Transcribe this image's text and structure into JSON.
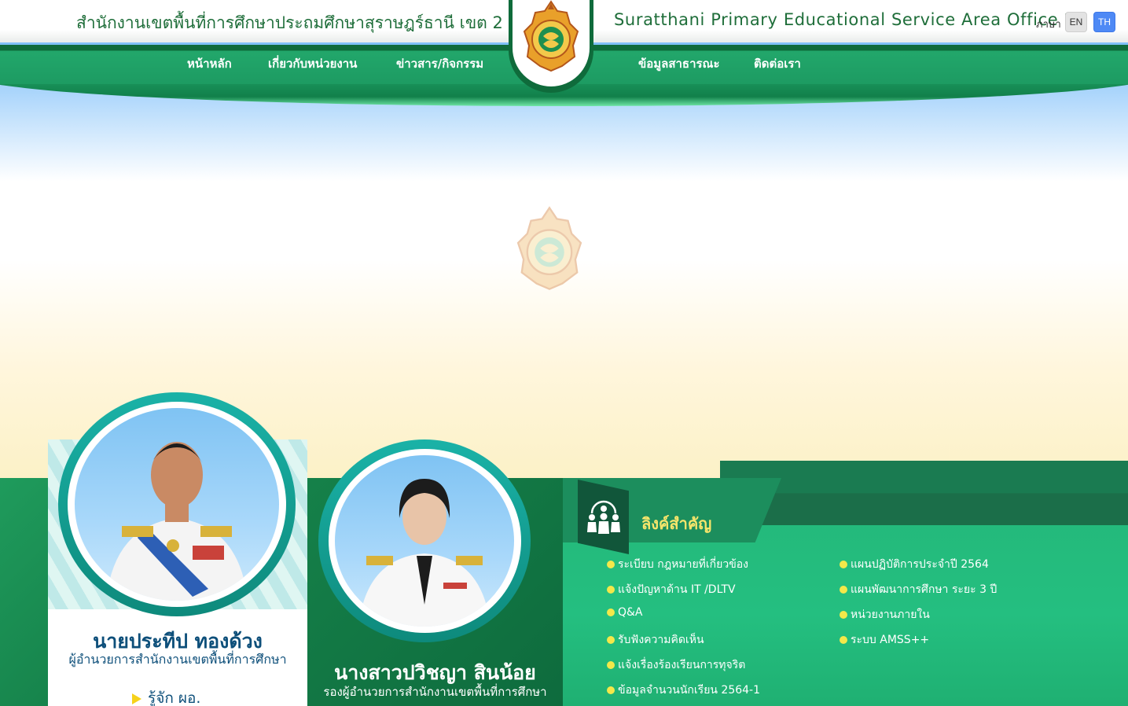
{
  "header": {
    "title_th": "สำนักงานเขตพื้นที่การศึกษาประถมศึกษาสุราษฎร์ธานี เขต 2",
    "title_en": "Suratthani Primary Educational Service Area Office 2",
    "lang_label": "ภาษา",
    "lang_en": "EN",
    "lang_th": "TH"
  },
  "nav": {
    "items": [
      "หน้าหลัก",
      "เกี่ยวกับหน่วยงาน",
      "ข่าวสาร/กิจกรรม",
      "ข้อมูลสาธารณะ",
      "ติดต่อเรา"
    ]
  },
  "colors": {
    "brand_green": "#1d9b62",
    "dark_green": "#0f6b3b",
    "accent_yellow": "#f6e56b",
    "lang_active": "#4e89f5"
  },
  "director": {
    "name": "นายประทีป ทองด้วง",
    "position": "ผู้อำนวยการสำนักงานเขตพื้นที่การศึกษา",
    "know_link": "รู้จัก  ผอ."
  },
  "deputy": {
    "name": "นางสาวปวิชญา สินน้อย",
    "position": "รองผู้อำนวยการสำนักงานเขตพื้นที่การศึกษา"
  },
  "links": {
    "title": "ลิงค์สำคัญ",
    "col1": [
      "ระเบียบ กฎหมายที่เกี่ยวข้อง",
      "แจ้งปัญหาด้าน IT /DLTV",
      "Q&A",
      "รับฟังความคิดเห็น",
      "แจ้งเรื่องร้องเรียนการทุจริต",
      "ข้อมูลจำนวนนักเรียน 2564-1"
    ],
    "col2": [
      "แผนปฏิบัติการประจำปี 2564",
      "แผนพัฒนาการศึกษา ระยะ 3 ปี",
      "หน่วยงานภายใน",
      "ระบบ AMSS++"
    ]
  }
}
